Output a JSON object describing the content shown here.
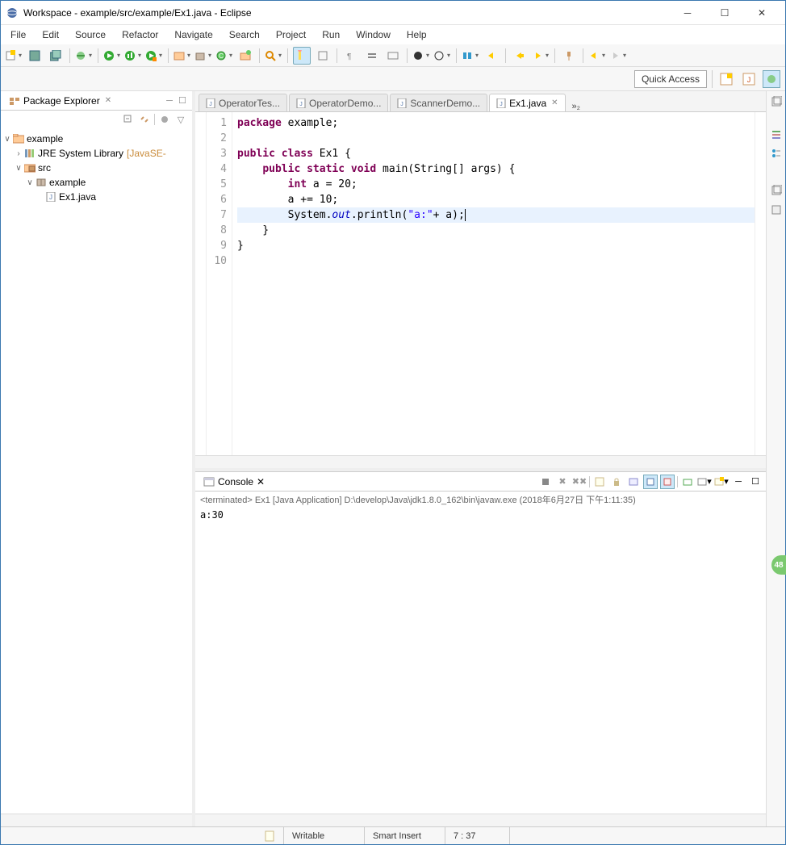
{
  "window": {
    "title": "Workspace - example/src/example/Ex1.java - Eclipse"
  },
  "menu": {
    "file": "File",
    "edit": "Edit",
    "source": "Source",
    "refactor": "Refactor",
    "navigate": "Navigate",
    "search": "Search",
    "project": "Project",
    "run": "Run",
    "window": "Window",
    "help": "Help"
  },
  "quick_access": "Quick Access",
  "package_explorer": {
    "title": "Package Explorer",
    "tree": {
      "project": "example",
      "jre": "JRE System Library",
      "jre_suffix": "[JavaSE-",
      "src": "src",
      "pkg": "example",
      "file": "Ex1.java"
    }
  },
  "editor": {
    "tabs": [
      "OperatorTes...",
      "OperatorDemo...",
      "ScannerDemo...",
      "Ex1.java"
    ],
    "more": "»₂",
    "line_numbers": [
      "1",
      "2",
      "3",
      "4",
      "5",
      "6",
      "7",
      "8",
      "9",
      "10"
    ],
    "code": {
      "l1_kw": "package",
      "l1_rest": " example;",
      "l3_kw1": "public",
      "l3_kw2": "class",
      "l3_rest": " Ex1 {",
      "l4_kw1": "public",
      "l4_kw2": "static",
      "l4_kw3": "void",
      "l4_rest": " main(String[] args) {",
      "l5_kw": "int",
      "l5_rest": " a = 20;",
      "l6": "        a += 10;",
      "l7_a": "        System.",
      "l7_field": "out",
      "l7_b": ".println(",
      "l7_str": "\"a:\"",
      "l7_c": "+ a);",
      "l8": "    }",
      "l9": "}"
    }
  },
  "console": {
    "title": "Console",
    "desc": "<terminated> Ex1 [Java Application] D:\\develop\\Java\\jdk1.8.0_162\\bin\\javaw.exe (2018年6月27日 下午1:11:35)",
    "output": "a:30"
  },
  "status": {
    "writable": "Writable",
    "insert": "Smart Insert",
    "position": "7 : 37"
  },
  "badge": "48"
}
